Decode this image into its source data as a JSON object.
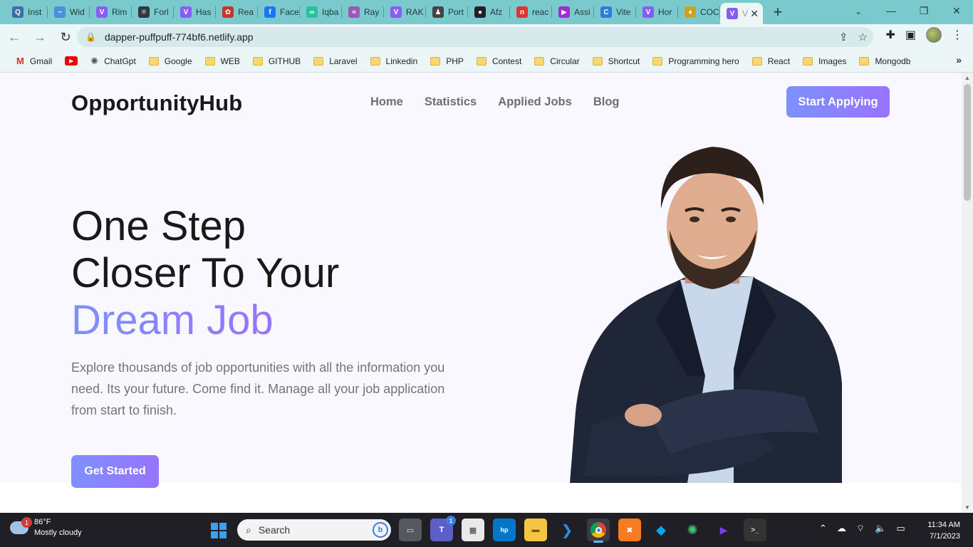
{
  "browser": {
    "tabs": [
      {
        "label": "Inst",
        "color": "#3a6ea5",
        "glyph": "Q"
      },
      {
        "label": "Wid",
        "color": "#4a90d9",
        "glyph": "~"
      },
      {
        "label": "Rim",
        "color": "#8a5cf6",
        "glyph": "V"
      },
      {
        "label": "Forl",
        "color": "#2f3640",
        "glyph": "⚛"
      },
      {
        "label": "Has",
        "color": "#8a5cf6",
        "glyph": "V"
      },
      {
        "label": "Rea",
        "color": "#c0392b",
        "glyph": "✿"
      },
      {
        "label": "Face",
        "color": "#1877f2",
        "glyph": "f"
      },
      {
        "label": "Iqba",
        "color": "#2bbf9a",
        "glyph": "∞"
      },
      {
        "label": "Ray",
        "color": "#9b59b6",
        "glyph": "≈"
      },
      {
        "label": "RAK",
        "color": "#8a5cf6",
        "glyph": "V"
      },
      {
        "label": "Port",
        "color": "#444",
        "glyph": "♟"
      },
      {
        "label": "Afz",
        "color": "#222",
        "glyph": "●"
      },
      {
        "label": "reac",
        "color": "#d33",
        "glyph": "n"
      },
      {
        "label": "Assi",
        "color": "#a12bd3",
        "glyph": "▶"
      },
      {
        "label": "Vite",
        "color": "#2d7be0",
        "glyph": "C"
      },
      {
        "label": "Hor",
        "color": "#8a5cf6",
        "glyph": "V"
      },
      {
        "label": "COC",
        "color": "#d0a020",
        "glyph": "♦"
      }
    ],
    "active_tab": {
      "label": "V",
      "color": "#8a5cf6",
      "glyph": "V"
    },
    "url": "dapper-puffpuff-774bf6.netlify.app",
    "bookmarks": [
      {
        "label": "Gmail",
        "kind": "gmail"
      },
      {
        "label": "",
        "kind": "youtube"
      },
      {
        "label": "ChatGpt",
        "kind": "chatgpt"
      },
      {
        "label": "Google",
        "kind": "folder"
      },
      {
        "label": "WEB",
        "kind": "folder"
      },
      {
        "label": "GITHUB",
        "kind": "folder"
      },
      {
        "label": "Laravel",
        "kind": "folder"
      },
      {
        "label": "Linkedin",
        "kind": "folder"
      },
      {
        "label": "PHP",
        "kind": "folder"
      },
      {
        "label": "Contest",
        "kind": "folder"
      },
      {
        "label": "Circular",
        "kind": "folder"
      },
      {
        "label": "Shortcut",
        "kind": "folder"
      },
      {
        "label": "Programming hero",
        "kind": "folder"
      },
      {
        "label": "React",
        "kind": "folder"
      },
      {
        "label": "Images",
        "kind": "folder"
      },
      {
        "label": "Mongodb",
        "kind": "folder"
      }
    ]
  },
  "site": {
    "brand": "OpportunityHub",
    "nav": [
      "Home",
      "Statistics",
      "Applied Jobs",
      "Blog"
    ],
    "cta": "Start Applying",
    "headline_line1": "One Step",
    "headline_line2": "Closer To Your",
    "headline_accent": "Dream Job",
    "description": "Explore thousands of job opportunities with all the information you need. Its your future. Come find it. Manage all your job application from start to finish.",
    "get_started": "Get Started",
    "accent_gradient": [
      "#7e90fe",
      "#9873ff"
    ]
  },
  "taskbar": {
    "weather_badge": "1",
    "temperature": "86°F",
    "condition": "Mostly cloudy",
    "search_placeholder": "Search",
    "teams_badge": "1",
    "time": "11:34 AM",
    "date": "7/1/2023"
  }
}
